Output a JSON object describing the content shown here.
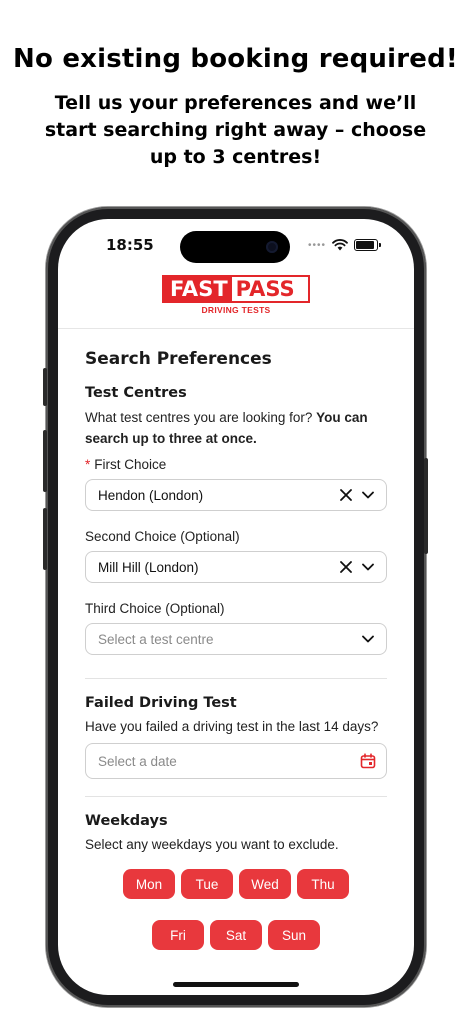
{
  "promo": {
    "headline": "No existing booking required!",
    "subline": "Tell us your preferences and we’ll start searching right away – choose up to 3 centres!"
  },
  "status_bar": {
    "time": "18:55",
    "signal_dots": "••••"
  },
  "logo": {
    "word1": "FAST",
    "word2": "PASS",
    "tagline": "DRIVING TESTS",
    "brand_color": "#e3262a"
  },
  "search": {
    "title": "Search Preferences",
    "centres": {
      "title": "Test Centres",
      "description": "What test centres you are looking for?",
      "description_bold": "You can search up to three at once.",
      "required_mark": "*",
      "first": {
        "label": "First Choice",
        "value": "Hendon (London)"
      },
      "second": {
        "label": "Second Choice (Optional)",
        "value": "Mill Hill (London)"
      },
      "third": {
        "label": "Third Choice (Optional)",
        "placeholder": "Select a test centre"
      }
    },
    "failed": {
      "title": "Failed Driving Test",
      "question": "Have you failed a driving test in the last 14 days?",
      "date_placeholder": "Select a date"
    },
    "weekdays": {
      "title": "Weekdays",
      "description": "Select any weekdays you want to exclude.",
      "days": [
        "Mon",
        "Tue",
        "Wed",
        "Thu",
        "Fri",
        "Sat",
        "Sun"
      ],
      "accent": "#e8383d"
    }
  }
}
